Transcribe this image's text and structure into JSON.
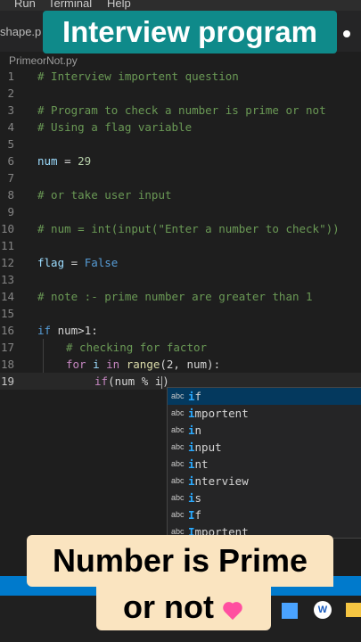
{
  "menubar": {
    "items": [
      "Run",
      "Terminal",
      "Help"
    ]
  },
  "tabbar": {
    "active_tab": "shape.p"
  },
  "banner": "Interview program",
  "breadcrumb": "PrimeorNot.py",
  "editor": {
    "line_numbers": [
      "1",
      "2",
      "3",
      "4",
      "5",
      "6",
      "7",
      "8",
      "9",
      "10",
      "11",
      "12",
      "13",
      "14",
      "15",
      "16",
      "17",
      "18",
      "19"
    ],
    "lines": {
      "l1": "# Interview importent question",
      "l3": "# Program to check a number is prime or not",
      "l4": "# Using a flag variable",
      "l6_var": "num",
      "l6_op": " = ",
      "l6_num": "29",
      "l8": "# or take user input",
      "l10": "# num = int(input(\"Enter a number to check\"))",
      "l12_var": "flag",
      "l12_op": " = ",
      "l12_val": "False",
      "l14": "# note :- prime number are greater than 1",
      "l16_kw": "if",
      "l16_rest": " num>1:",
      "l17": "# checking for factor",
      "l18_for": "for",
      "l18_i": " i ",
      "l18_in": "in",
      "l18_range": " range",
      "l18_rest": "(2, num):",
      "l19_if": "if",
      "l19_rest": "(num % i"
    }
  },
  "suggestions": {
    "icon_label": "abc",
    "items": [
      {
        "match": "i",
        "rest": "f"
      },
      {
        "match": "i",
        "rest": "mportent"
      },
      {
        "match": "i",
        "rest": "n"
      },
      {
        "match": "i",
        "rest": "nput"
      },
      {
        "match": "i",
        "rest": "nt"
      },
      {
        "match": "i",
        "rest": "nterview"
      },
      {
        "match": "i",
        "rest": "s"
      },
      {
        "match": "I",
        "rest": "f"
      },
      {
        "match": "I",
        "rest": "mportent"
      }
    ]
  },
  "captions": {
    "line1": "Number is Prime",
    "line2": "or not"
  },
  "taskbar": {
    "word_icon_letter": "W"
  },
  "colors": {
    "comment": "#6a9955",
    "keyword": "#569cd6",
    "control": "#c586c0",
    "number": "#b5cea8",
    "banner": "#0f8a8a",
    "caption_bg": "#fae4c0"
  }
}
